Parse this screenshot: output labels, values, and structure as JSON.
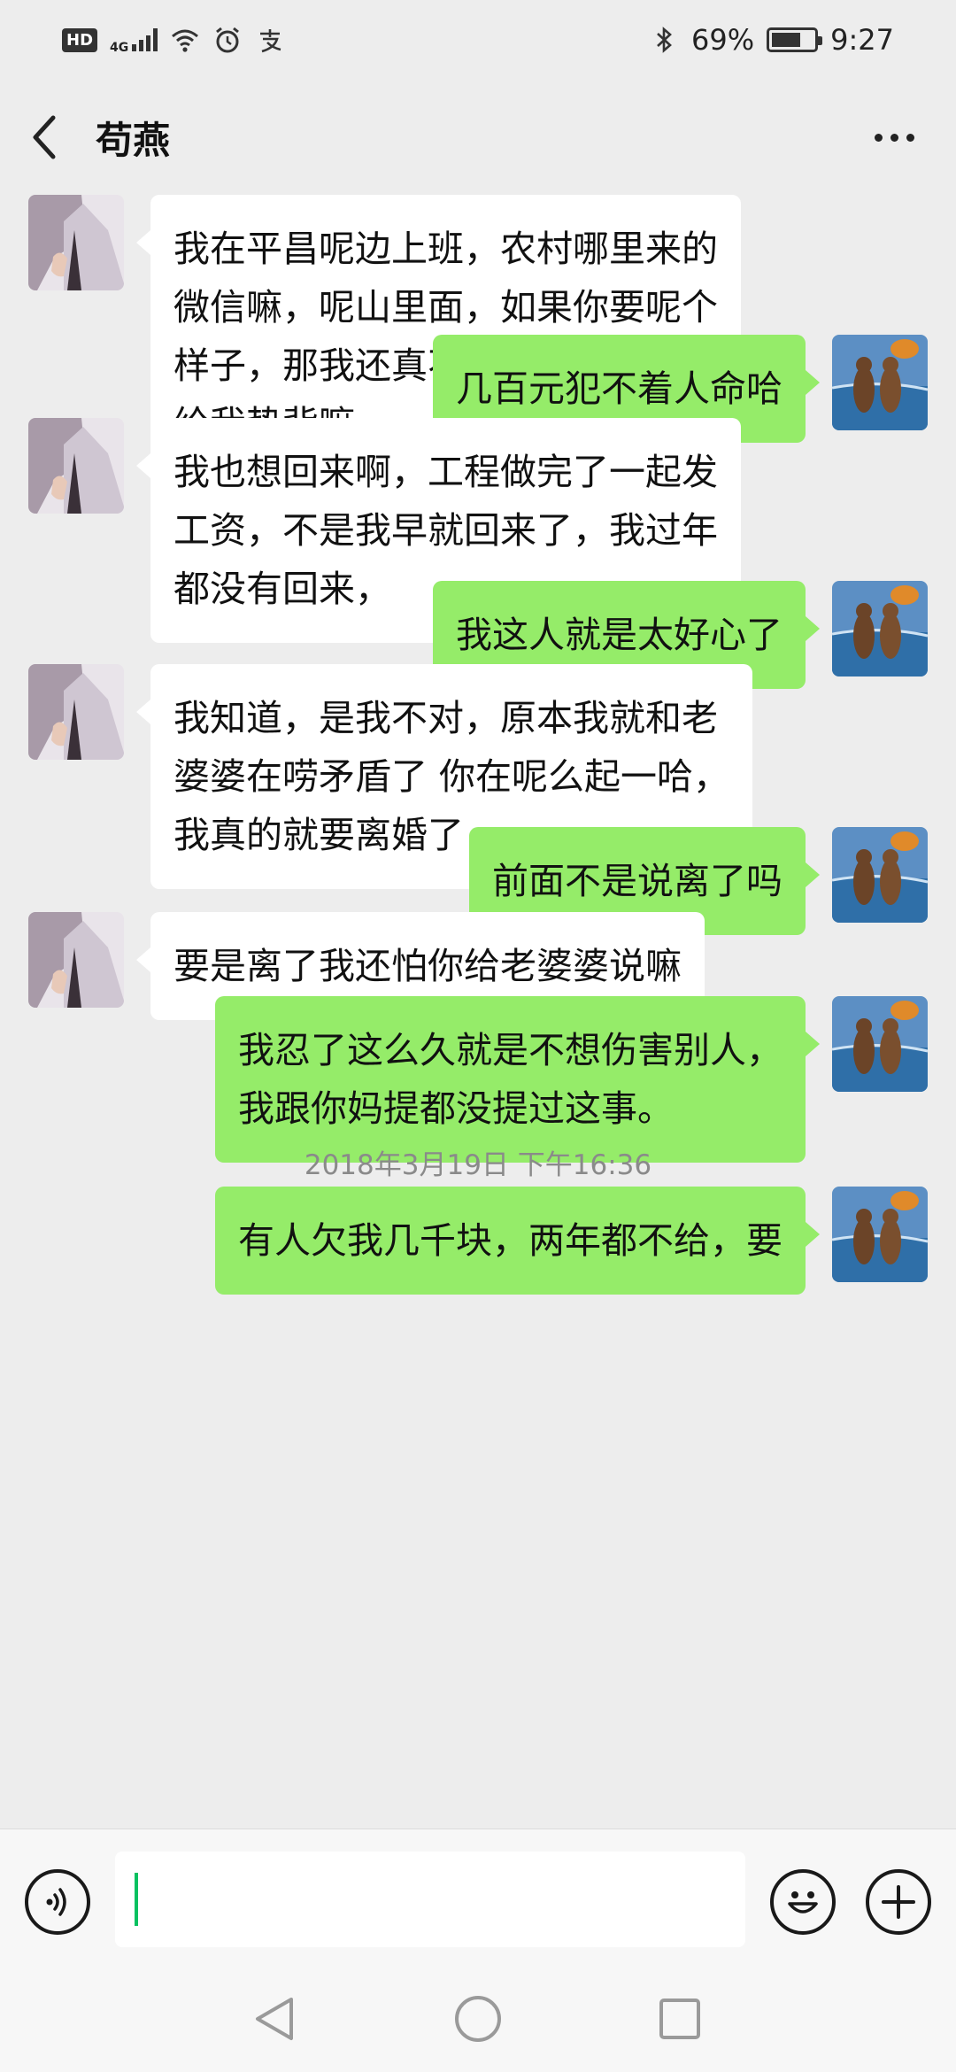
{
  "status_bar": {
    "hd": "HD",
    "network": "4G",
    "battery_text": "69%",
    "battery_level": 0.69,
    "time": "9:27"
  },
  "header": {
    "title": "苟燕"
  },
  "messages": [
    {
      "side": "in",
      "text": "我在平昌呢边上班，农村哪里来的\n微信嘛，呢山里面，如果你要呢个\n样子，那我还真不怕，我死总有人\n给我垫背嘛，"
    },
    {
      "side": "out",
      "text": "几百元犯不着人命哈"
    },
    {
      "side": "in",
      "text": "我也想回来啊，工程做完了一起发\n工资，不是我早就回来了，我过年\n都没有回来，"
    },
    {
      "side": "out",
      "text": "我这人就是太好心了"
    },
    {
      "side": "in",
      "text": "我知道，是我不对，原本我就和老\n婆婆在唠矛盾了 你在呢么起一哈，\n我真的就要离婚了"
    },
    {
      "side": "out",
      "text": "前面不是说离了吗"
    },
    {
      "side": "in",
      "text": "要是离了我还怕你给老婆婆说嘛"
    },
    {
      "side": "out",
      "text": "我忍了这么久就是不想伤害别人，\n我跟你妈提都没提过这事。"
    },
    {
      "type": "timestamp",
      "text": "2018年3月19日 下午16:36"
    },
    {
      "side": "out",
      "text": "有人欠我几千块，两年都不给，要"
    }
  ],
  "input": {
    "value": ""
  },
  "colors": {
    "background": "#ededed",
    "incoming_bubble": "#ffffff",
    "outgoing_bubble": "#95ec69",
    "caret": "#07c160"
  },
  "icons": {
    "back": "chevron-left-icon",
    "more": "more-dots-icon",
    "voice": "voice-icon",
    "emoji": "emoji-icon",
    "plus": "plus-icon",
    "nav_back": "nav-back-icon",
    "nav_home": "nav-home-icon",
    "nav_recents": "nav-recents-icon"
  }
}
